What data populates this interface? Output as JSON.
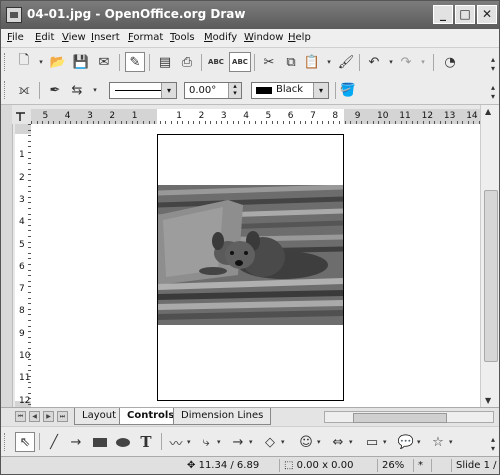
{
  "window": {
    "title": "04-01.jpg - OpenOffice.org Draw",
    "controls": {
      "minimize": "_",
      "maximize": "□",
      "close": "✕"
    }
  },
  "menu": {
    "items": [
      {
        "label": "File"
      },
      {
        "label": "Edit"
      },
      {
        "label": "View"
      },
      {
        "label": "Insert"
      },
      {
        "label": "Format"
      },
      {
        "label": "Tools"
      },
      {
        "label": "Modify"
      },
      {
        "label": "Window"
      },
      {
        "label": "Help"
      }
    ]
  },
  "toolbar_standard": {
    "icons": [
      "new-icon",
      "open-icon",
      "save-icon",
      "email-icon",
      "edit-file-icon",
      "export-pdf-icon",
      "print-icon",
      "spellcheck-icon",
      "autospellcheck-icon",
      "cut-icon",
      "copy-icon",
      "paste-icon",
      "format-paintbrush-icon",
      "undo-icon",
      "redo-icon",
      "chart-icon"
    ]
  },
  "toolbar_line_fill": {
    "line_style": "",
    "angle_value": "0.00°",
    "area_color_label": "Black",
    "area_color_hex": "#000000"
  },
  "rulers": {
    "horizontal_labels": [
      "5",
      "4",
      "3",
      "2",
      "1",
      "1",
      "2",
      "3",
      "4",
      "5",
      "6",
      "7",
      "8",
      "9",
      "10",
      "11",
      "12",
      "13",
      "14"
    ],
    "vertical_labels": [
      "1",
      "2",
      "3",
      "4",
      "5",
      "6",
      "7",
      "8",
      "9",
      "10",
      "11",
      "12"
    ]
  },
  "tabs": {
    "items": [
      {
        "label": "Layout"
      },
      {
        "label": "Controls"
      },
      {
        "label": "Dimension Lines"
      }
    ],
    "active": "Controls"
  },
  "drawing_toolbar": {
    "icons": [
      "select-icon",
      "line-icon",
      "arrow-line-icon",
      "rectangle-icon",
      "ellipse-icon",
      "text-icon",
      "curve-icon",
      "connector-icon",
      "lines-arrows-icon",
      "basic-shapes-icon",
      "symbol-shapes-icon",
      "block-arrows-icon",
      "flowchart-icon",
      "callouts-icon",
      "stars-icon"
    ],
    "text_tool_glyph": "T"
  },
  "status": {
    "position": "11.34 / 6.89",
    "size": "0.00 x 0.00",
    "zoom": "26%",
    "modified": "*",
    "slide": "Slide 1 /"
  }
}
